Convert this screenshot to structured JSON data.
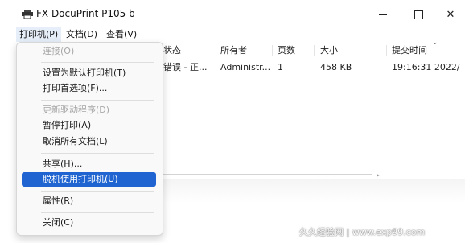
{
  "window": {
    "title": "FX DocuPrint P105 b",
    "buttons": {
      "minimize": "minimize-icon",
      "maximize": "maximize-icon",
      "close": "✕"
    }
  },
  "menubar": {
    "items": [
      "打印机(P)",
      "文档(D)",
      "查看(V)"
    ]
  },
  "dropdown": {
    "items": [
      {
        "label": "连接(O)",
        "disabled": true
      },
      {
        "label": "设置为默认打印机(T)"
      },
      {
        "label": "打印首选项(F)..."
      },
      {
        "label": "更新驱动程序(D)",
        "disabled": true
      },
      {
        "label": "暂停打印(A)"
      },
      {
        "label": "取消所有文档(L)"
      },
      {
        "label": "共享(H)..."
      },
      {
        "label": "脱机使用打印机(U)",
        "highlighted": true
      },
      {
        "label": "属性(R)"
      },
      {
        "label": "关闭(C)"
      }
    ]
  },
  "columns": [
    "状态",
    "所有者",
    "页数",
    "大小",
    "提交时间"
  ],
  "rows": [
    {
      "status": "错误 - 正...",
      "owner": "Administr...",
      "pages": "1",
      "size": "458 KB",
      "submitted": "19:16:31  2022/"
    }
  ],
  "watermark": "久久经验网 | www.exp99.com",
  "colors": {
    "highlight": "#1f64d0",
    "menu_bg": "#f9f9f9"
  }
}
